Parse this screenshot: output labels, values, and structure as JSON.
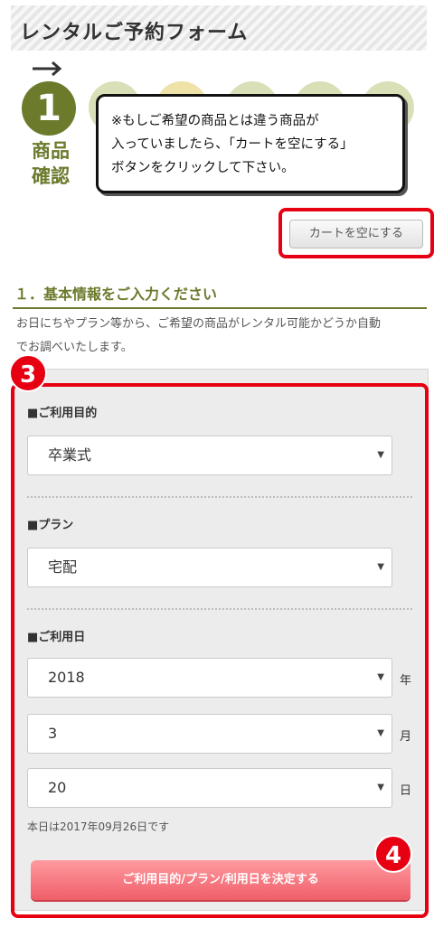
{
  "page": {
    "title": "レンタルご予約フォーム"
  },
  "steps": {
    "current_number": "1",
    "current_label_line1": "商品",
    "current_label_line2": "確認"
  },
  "tooltip": {
    "line1": "※もしご希望の商品とは違う商品が",
    "line2": "入っていましたら、「カートを空にする」",
    "line3": "ボタンをクリックして下さい。"
  },
  "cart": {
    "empty_button_label": "カートを空にする"
  },
  "section": {
    "heading": "１．基本情報をご入力ください",
    "desc_line1": "お日にちやプラン等から、ご希望の商品がレンタル可能かどうか自動",
    "desc_line2": "でお調べいたします。"
  },
  "badges": {
    "form": "3",
    "submit": "4"
  },
  "form": {
    "purpose_label": "■ご利用目的",
    "purpose_value": "卒業式",
    "plan_label": "■プラン",
    "plan_value": "宅配",
    "date_label": "■ご利用日",
    "year_value": "2018",
    "year_unit": "年",
    "month_value": "3",
    "month_unit": "月",
    "day_value": "20",
    "day_unit": "日",
    "today_note": "本日は2017年09月26日です",
    "submit_label": "ご利用目的/プラン/利用日を決定する"
  },
  "colors": {
    "accent_green": "#6b7a2b",
    "highlight_red": "#e60012",
    "submit_pink": "#ef5e68"
  }
}
